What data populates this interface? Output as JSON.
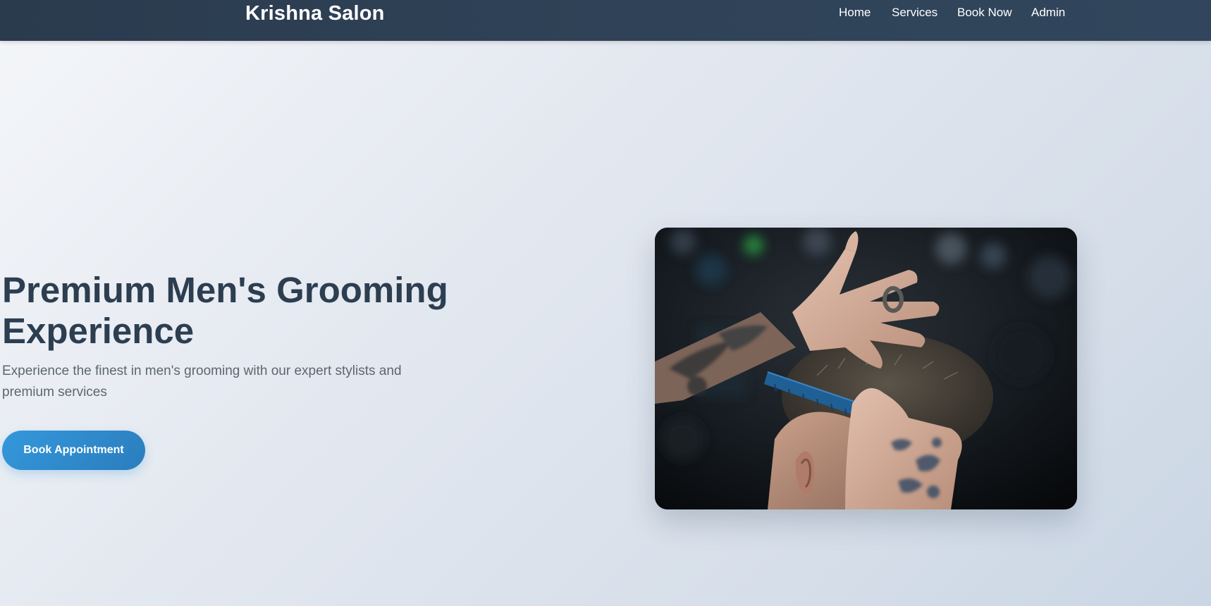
{
  "nav": {
    "brand": "Krishna Salon",
    "links": [
      {
        "label": "Home"
      },
      {
        "label": "Services"
      },
      {
        "label": "Book Now"
      },
      {
        "label": "Admin"
      }
    ]
  },
  "hero": {
    "title_line1": "Premium Men's Grooming",
    "title_line2": "Experience",
    "subtitle_line1": "Experience the finest in men's grooming with our expert stylists and",
    "subtitle_line2": "premium services",
    "cta_label": "Book Appointment",
    "image_alt": "Barber cutting a man's hair with a comb"
  },
  "colors": {
    "navbar": "#2c3e50",
    "accent": "#3498db",
    "title": "#2c3e50",
    "subtitle": "#5d6670"
  }
}
